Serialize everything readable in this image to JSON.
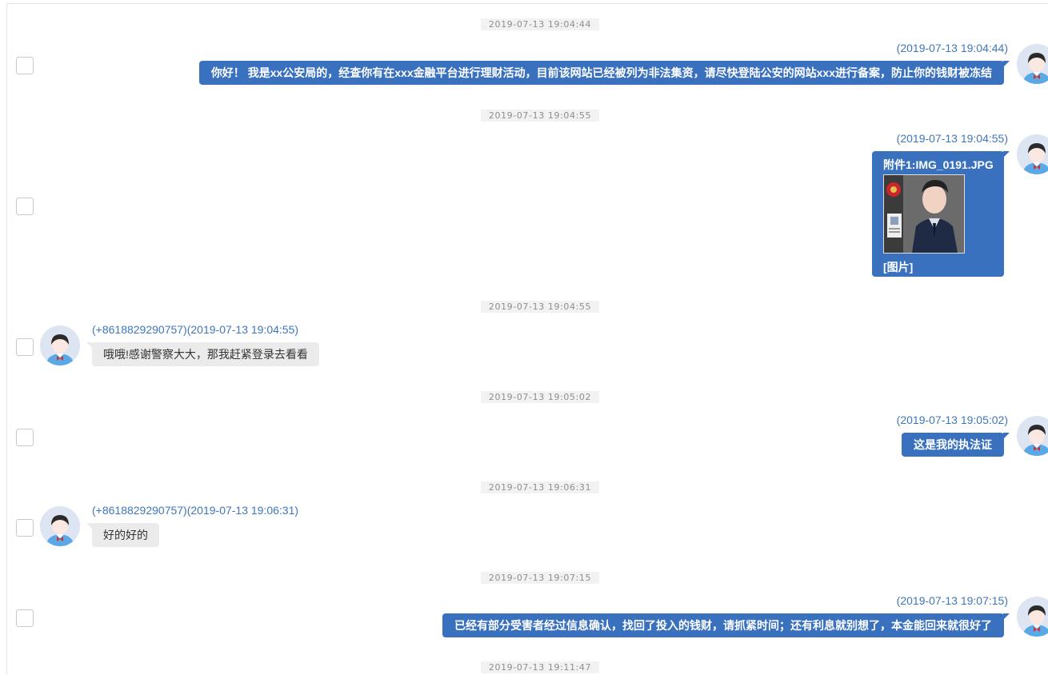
{
  "messages": [
    {
      "separator": "2019-07-13 19:04:44",
      "direction": "out",
      "meta": "(2019-07-13 19:04:44)",
      "text": "你好！ 我是xx公安局的，经查你有在xxx金融平台进行理财活动，目前该网站已经被列为非法集资，请尽快登陆公安的网站xxx进行备案，防止你的钱财被冻结"
    },
    {
      "separator": "2019-07-13 19:04:55",
      "direction": "out",
      "meta": "(2019-07-13 19:04:55)",
      "attachment": {
        "title": "附件1:IMG_0191.JPG",
        "caption": "[图片]"
      }
    },
    {
      "separator": "2019-07-13 19:04:55",
      "direction": "in",
      "meta": "(+8618829290757)(2019-07-13 19:04:55)",
      "text": "哦哦!感谢警察大大，那我赶紧登录去看看"
    },
    {
      "separator": "2019-07-13 19:05:02",
      "direction": "out",
      "meta": "(2019-07-13 19:05:02)",
      "text": "这是我的执法证"
    },
    {
      "separator": "2019-07-13 19:06:31",
      "direction": "in",
      "meta": "(+8618829290757)(2019-07-13 19:06:31)",
      "text": "好的好的"
    },
    {
      "separator": "2019-07-13 19:07:15",
      "direction": "out",
      "meta": "(2019-07-13 19:07:15)",
      "text": "已经有部分受害者经过信息确认，找回了投入的钱财，请抓紧时间；还有利息就别想了，本金能回来就很好了"
    },
    {
      "separator": "2019-07-13 19:11:47"
    }
  ],
  "colors": {
    "outgoing_bubble": "#3a71bf",
    "incoming_bubble": "#ebebeb",
    "meta_text": "#3f76bb",
    "separator_bg": "#f2f2f2"
  },
  "icons": {
    "avatar": "person-avatar-icon",
    "checkbox": "checkbox-icon"
  }
}
